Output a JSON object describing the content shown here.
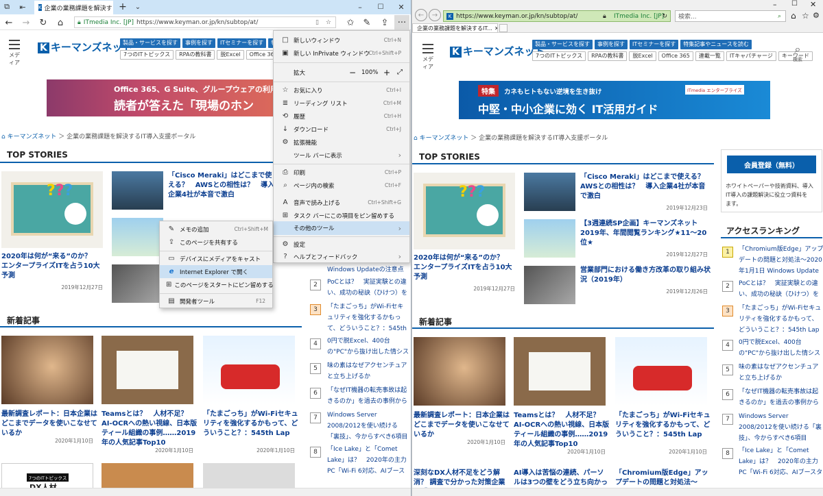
{
  "edge": {
    "tab_title": "企業の業務課題を解決す",
    "url_org": "ITmedia Inc. [JP]",
    "url": "https://www.keyman.or.jp/kn/subtop/at/",
    "menu": {
      "items": [
        {
          "icon": "□",
          "label": "新しいウィンドウ",
          "shortcut": "Ctrl+N"
        },
        {
          "icon": "▣",
          "label": "新しい InPrivate ウィンドウ",
          "shortcut": "Ctrl+Shift+P"
        },
        {
          "icon": "",
          "label": "拡大",
          "shortcut": ""
        },
        {
          "icon": "☆",
          "label": "お気に入り",
          "shortcut": "Ctrl+I"
        },
        {
          "icon": "≣",
          "label": "リーディング リスト",
          "shortcut": "Ctrl+M"
        },
        {
          "icon": "⟲",
          "label": "履歴",
          "shortcut": "Ctrl+H"
        },
        {
          "icon": "↓",
          "label": "ダウンロード",
          "shortcut": "Ctrl+J"
        },
        {
          "icon": "⚙",
          "label": "拡張機能",
          "shortcut": ""
        },
        {
          "icon": "",
          "label": "ツール バーに表示",
          "shortcut": "›"
        },
        {
          "icon": "⎙",
          "label": "印刷",
          "shortcut": "Ctrl+P"
        },
        {
          "icon": "⌕",
          "label": "ページ内の検索",
          "shortcut": "Ctrl+F"
        },
        {
          "icon": "A",
          "label": "音声で読み上げる",
          "shortcut": "Ctrl+Shift+G"
        },
        {
          "icon": "⊞",
          "label": "タスク バーにこの項目をピン留めする",
          "shortcut": ""
        },
        {
          "icon": "",
          "label": "その他のツール",
          "shortcut": "›"
        },
        {
          "icon": "⚙",
          "label": "設定",
          "shortcut": ""
        },
        {
          "icon": "?",
          "label": "ヘルプとフィードバック",
          "shortcut": "›"
        }
      ],
      "zoom_value": "100%"
    },
    "submenu": {
      "items": [
        {
          "icon": "✎",
          "label": "メモの追加",
          "shortcut": "Ctrl+Shift+M"
        },
        {
          "icon": "⇪",
          "label": "このページを共有する",
          "shortcut": ""
        },
        {
          "icon": "▭",
          "label": "デバイスにメディアをキャスト",
          "shortcut": ""
        },
        {
          "icon": "e",
          "label": "Internet Explorer で開く",
          "shortcut": ""
        },
        {
          "icon": "⊞",
          "label": "このページをスタートにピン留めする",
          "shortcut": ""
        },
        {
          "icon": "▤",
          "label": "開発者ツール",
          "shortcut": "F12"
        }
      ]
    }
  },
  "ie": {
    "url": "https://www.keyman.or.jp/kn/subtop/at/",
    "url_org": "ITmedia Inc. [JP]",
    "search_placeholder": "検索...",
    "tab_title": "企業の業務課題を解決するIT..."
  },
  "site": {
    "menu_label": "メディア",
    "logo_k": "K",
    "logo_text": "キーマンズネット",
    "nav_primary": [
      "製品・サービスを探す",
      "事例を探す",
      "ITセミナーを探す",
      "特集記事やニュースを読む"
    ],
    "nav_secondary_edge": [
      "7つのITトピックス",
      "RPAの教科書",
      "脱Excel",
      "Office 365",
      "逆算"
    ],
    "nav_secondary_ie": [
      "7つのITトピックス",
      "RPAの教科書",
      "脱Excel",
      "Office 365",
      "連載一覧",
      "ITキャパチャージ",
      "キーワード"
    ],
    "search_label": "検索",
    "banner_edge": {
      "line1": "Office 365、G Suite、グループウェアの利用実",
      "line2": "読者が答えた「現場のホン"
    },
    "banner_ie": {
      "tag": "特集",
      "line1": "カネもヒトもない逆境を生き抜け",
      "line2": "中堅・中小企業に効く IT活用ガイド",
      "brand": "ITmedia エンタープライズ"
    },
    "crumb_home": "キーマンズネット",
    "crumb_page": "企業の業務課題を解決するIT導入支援ポータル",
    "top_stories": "TOP STORIES",
    "new_articles": "新着記事",
    "ranking_title": "アクセスランキング",
    "member": {
      "button": "会員登録（無料）",
      "text": "ホワイトペーパーや技術資料、導入\nIT導入の課題解決に役立つ資料を\nます。"
    },
    "stories": [
      {
        "title": "2020年は何が“来る”のか？　エンタープライズITを占う10大予測",
        "date": "2019年12月27日"
      },
      {
        "title": "「Cisco Meraki」はどこまで使える？　AWSとの相性は？　導入企業4社が本音で激白",
        "date": "2019年12月23日"
      },
      {
        "title": "【3週連続SP企画】キーマンズネット 2019年、年間閲覧ランキング★11〜20位★",
        "date": "2019年12月27日"
      },
      {
        "title": "営業部門における働き方改革の取り組み状況（2019年）",
        "date": "2019年12月26日"
      }
    ],
    "news": [
      {
        "title": "最新調査レポート：日本企業はどこまでデータを使いこなせているか",
        "date": "2020年1月10日"
      },
      {
        "title": "Teamsとは？　人材不足？ AI-OCRへの熱い視線、日本版ティール組織の事例……2019年の人気記事Top10",
        "date": "2020年1月10日"
      },
      {
        "title": "「たまごっち」がWi-Fiセキュリティを強化するかもって、どういうこと？：545th Lap",
        "date": "2020年1月10日"
      }
    ],
    "news_row2": [
      {
        "title": "深刻なDX人材不足をどう解消？ 調査で分かった対策企業の「DX"
      },
      {
        "title": "AI導入は苦悩の連続、パーソルは3つの壁をどう立ち向かったの"
      },
      {
        "title": "「Chromium版Edge」アップデートの問題と対処法〜2020年"
      }
    ],
    "ranking": [
      {
        "n": "1",
        "text": "「Chromium版Edge」アップデートの問題と対処法〜2020年1月1日 Windows Updateの注意点"
      },
      {
        "n": "2",
        "text": "PoCとは？　実証実験との違い、成功の秘訣（ひけつ）を"
      },
      {
        "n": "3",
        "text": "「たまごっち」がWi-Fiセキュリティを強化するかもって、どういうこと？：545th Lap"
      },
      {
        "n": "4",
        "text": "0円で脱Excel、400台の\"PC\"から抜け出した情シスの物語"
      },
      {
        "n": "5",
        "text": "味の素はなぜアクセンチュアと立ち上げるか"
      },
      {
        "n": "6",
        "text": "「なぜIT機器の転売事故は起きるのか」を過去の事例から探る"
      },
      {
        "n": "7",
        "text": "Windows Server 2008/2012を使い続ける「裏技」、今からすべき6項目"
      },
      {
        "n": "8",
        "text": "「Ice Lake」と「Comet Lake」は？　2020年の主力PC「Wi-Fi 6対応、AIブースター付き」で何"
      }
    ],
    "pickup_label": "7つのITトピックス",
    "pickup_sub": "DX人材"
  },
  "colors": {
    "brand_blue": "#0a5fab",
    "menu_highlight": "#cbe0f3",
    "edge_tabbar": "#cde4f7",
    "ie_url_green": "#cfe8b8"
  }
}
